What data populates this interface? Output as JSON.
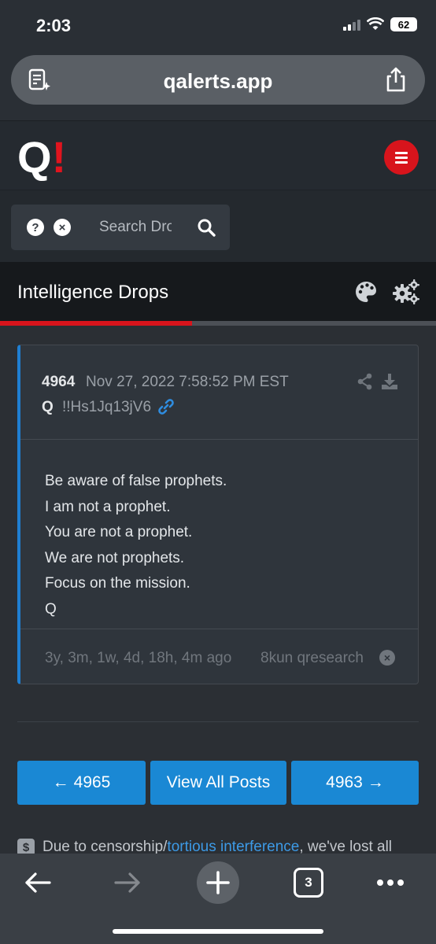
{
  "status_bar": {
    "time": "2:03",
    "battery": "62"
  },
  "browser": {
    "url": "qalerts.app",
    "tab_count": "3"
  },
  "site": {
    "logo_q": "Q",
    "logo_bang": "!"
  },
  "search": {
    "placeholder": "Search Drops",
    "help_glyph": "?",
    "clear_glyph": "×"
  },
  "page": {
    "title": "Intelligence Drops",
    "progress_fraction": 0.44
  },
  "post": {
    "number": "4964",
    "date": "Nov 27, 2022 7:58:52 PM EST",
    "author": "Q",
    "tripcode": "!!Hs1Jq13jV6",
    "body_lines": [
      "Be aware of false prophets.",
      "I am not a prophet.",
      "You are not a prophet.",
      "We are not prophets.",
      "Focus on the mission.",
      "Q"
    ],
    "age": "3y, 3m, 1w, 4d, 18h, 4m ago",
    "source": "8kun qresearch"
  },
  "nav": {
    "prev_label": "4965",
    "all_label": "View All Posts",
    "next_label": "4963",
    "prev_arrow": "←",
    "next_arrow": "→"
  },
  "notice": {
    "dollar_glyph": "$",
    "prefix": "Due to censorship/",
    "link_text": "tortious interference",
    "suffix": ", we've lost all"
  },
  "colors": {
    "accent_red": "#d8141c",
    "link_blue": "#1a88d4",
    "card_border": "#1f7fd2"
  }
}
